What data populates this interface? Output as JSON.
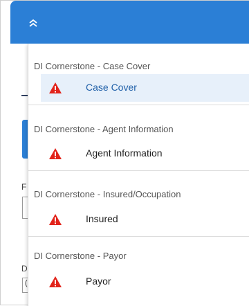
{
  "header": {
    "collapse_icon": "double-chevron-up-icon",
    "color": "#2b7fd6"
  },
  "background": {
    "field_letter_1": "F",
    "field_letter_2": "D",
    "field_value_fragment": "("
  },
  "dropdown": {
    "groups": [
      {
        "title": "DI Cornerstone - Case Cover",
        "item": {
          "label": "Case Cover",
          "icon": "warning-icon",
          "selected": true
        }
      },
      {
        "title": "DI Cornerstone - Agent Information",
        "item": {
          "label": "Agent Information",
          "icon": "warning-icon",
          "selected": false
        }
      },
      {
        "title": "DI Cornerstone - Insured/Occupation",
        "item": {
          "label": "Insured",
          "icon": "warning-icon",
          "selected": false
        }
      },
      {
        "title": "DI Cornerstone - Payor",
        "item": {
          "label": "Payor",
          "icon": "warning-icon",
          "selected": false
        }
      }
    ]
  },
  "colors": {
    "accent": "#2b7fd6",
    "warning": "#e2231a",
    "selected_bg": "#e7f0fa"
  }
}
